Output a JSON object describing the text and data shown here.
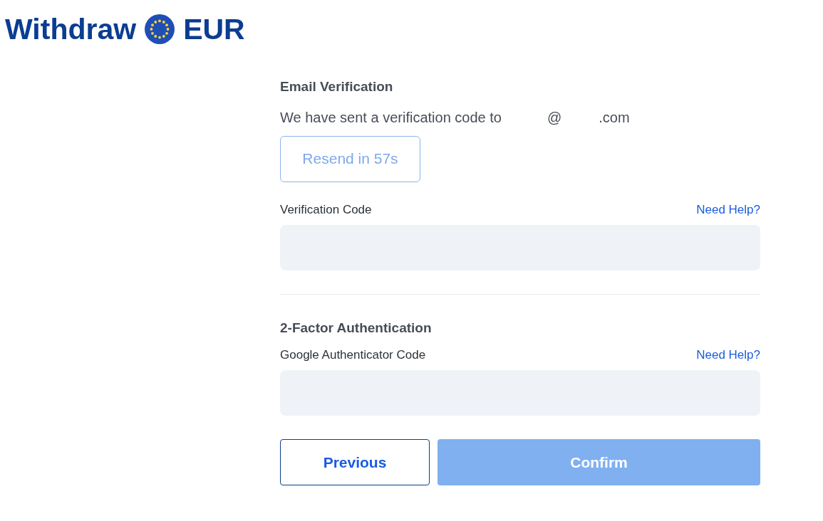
{
  "title": {
    "prefix": "Withdraw",
    "currency": "EUR"
  },
  "email_verification": {
    "heading": "Email Verification",
    "message": "We have sent a verification code to",
    "email_parts": [
      "@",
      ".com"
    ],
    "resend_button": {
      "label": "Resend in 57s",
      "disabled": true
    }
  },
  "fields": [
    {
      "label": "Verification Code",
      "help_link": "Need Help?"
    },
    {
      "label": "Google Authenticator Code",
      "help_link": "Need Help?",
      "heading": "2-Factor Authentication"
    }
  ],
  "buttons": {
    "previous": "Previous",
    "confirm": {
      "label": "Confirm",
      "disabled": true
    }
  }
}
